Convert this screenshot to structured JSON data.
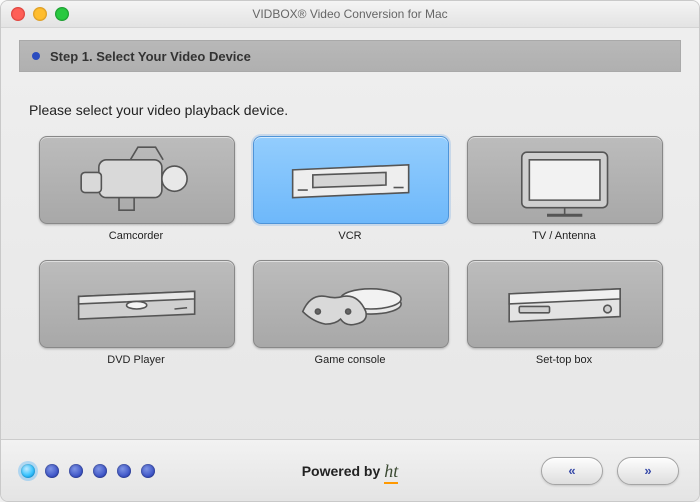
{
  "window": {
    "title": "VIDBOX® Video Conversion for Mac"
  },
  "step_header": {
    "label": "Step 1. Select Your Video Device"
  },
  "instruction": "Please select your video playback device.",
  "devices": [
    {
      "label": "Camcorder",
      "icon": "camcorder-icon",
      "selected": false
    },
    {
      "label": "VCR",
      "icon": "vcr-icon",
      "selected": true
    },
    {
      "label": "TV / Antenna",
      "icon": "tv-icon",
      "selected": false
    },
    {
      "label": "DVD Player",
      "icon": "dvd-player-icon",
      "selected": false
    },
    {
      "label": "Game console",
      "icon": "game-console-icon",
      "selected": false
    },
    {
      "label": "Set-top box",
      "icon": "settop-box-icon",
      "selected": false
    }
  ],
  "progress": {
    "steps_total": 6,
    "current_step": 1
  },
  "footer": {
    "powered_by_label": "Powered by",
    "brand_tag": "ht",
    "prev_glyph": "«",
    "next_glyph": "»"
  },
  "colors": {
    "accent_blue": "#3b52c6",
    "selected_bg": "#7fc3fb",
    "tile_bg": "#b2b2b2"
  }
}
